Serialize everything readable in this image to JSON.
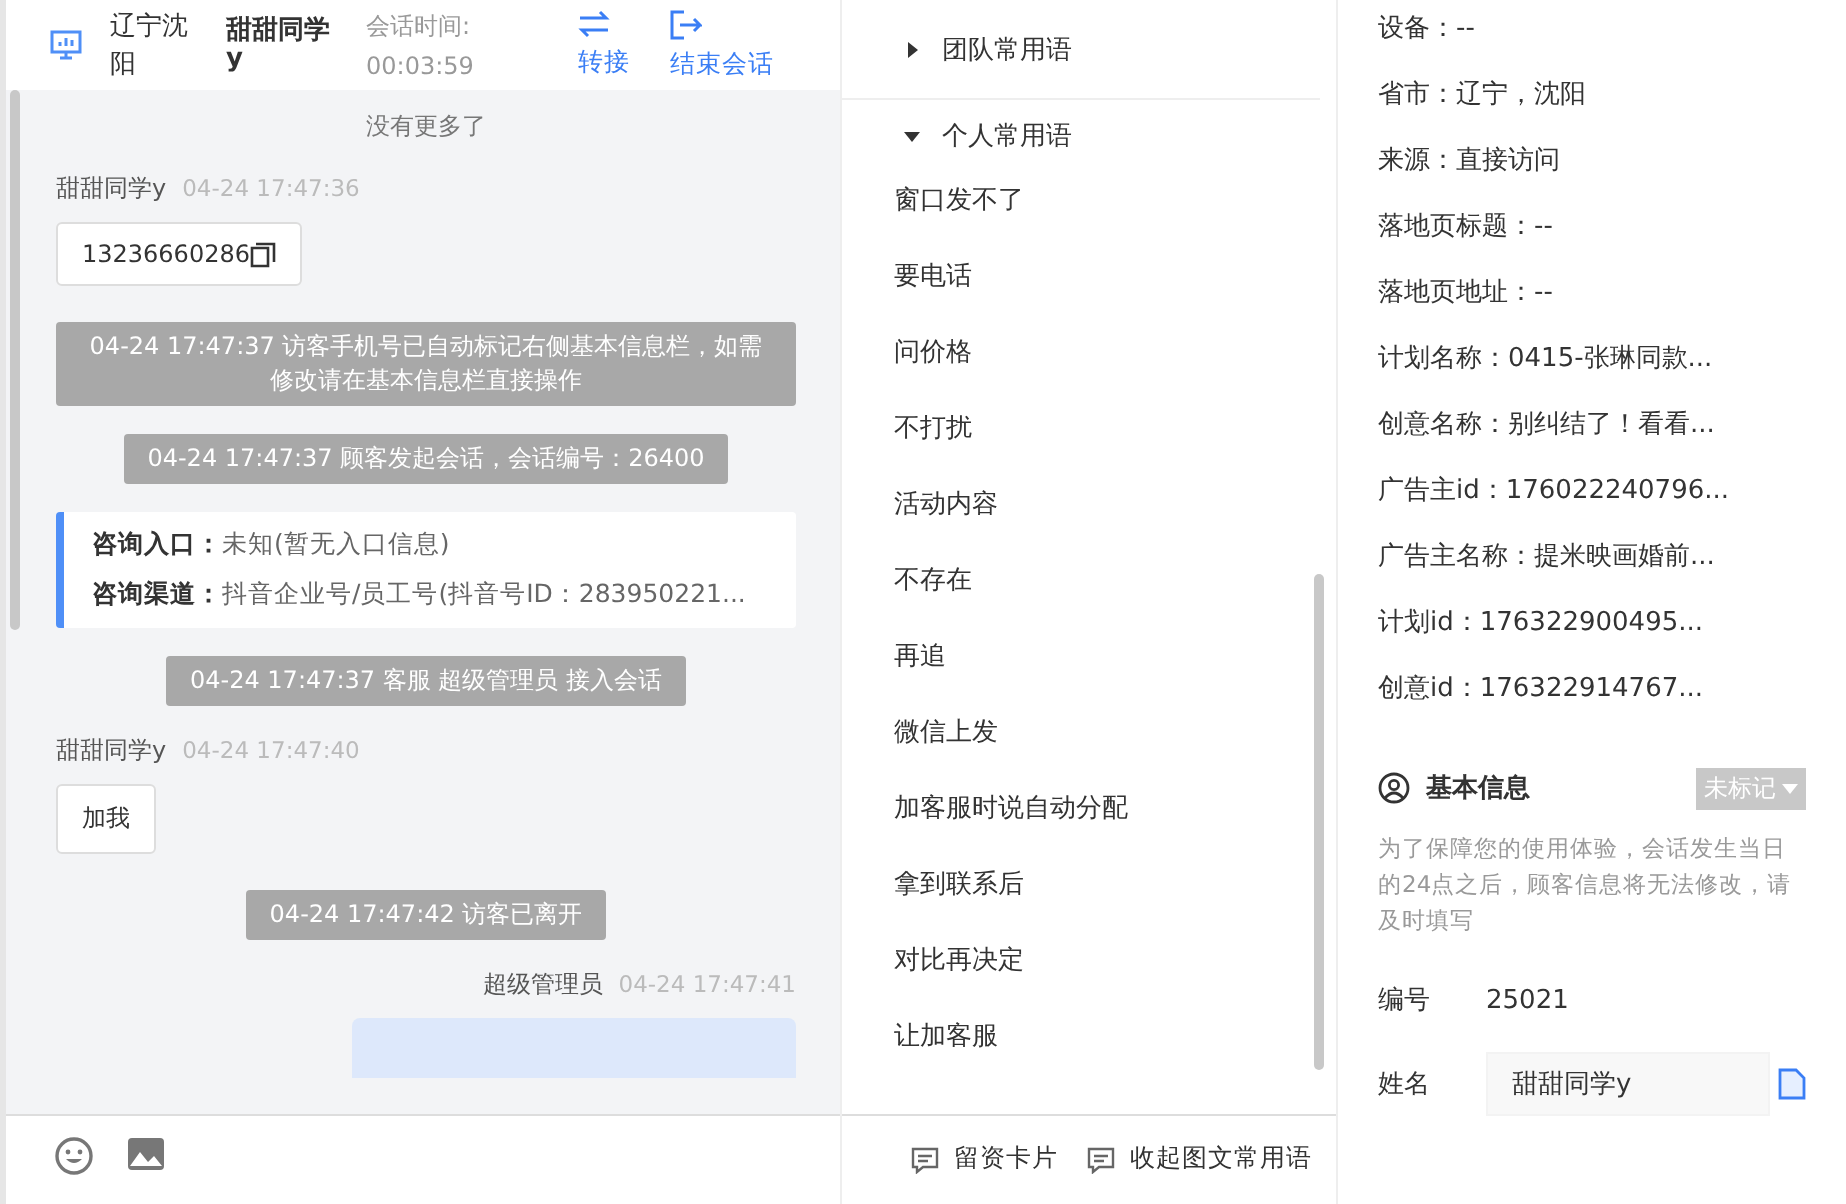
{
  "header": {
    "location": "辽宁沈阳",
    "visitor_name": "甜甜同学y",
    "session_time_label": "会话时间:",
    "session_time": "00:03:59",
    "actions": [
      {
        "label": "转接",
        "kind": "transfer"
      },
      {
        "label": "结束会话",
        "kind": "end"
      }
    ]
  },
  "chat": {
    "top_notice": "没有更多了",
    "messages": [
      {
        "kind": "visitor",
        "sender": "甜甜同学y",
        "time": "04-24 17:47:36",
        "text": "13236660286",
        "copyable": true
      },
      {
        "kind": "system",
        "text": "04-24 17:47:37 访客手机号已自动标记右侧基本信息栏，如需修改请在基本信息栏直接操作"
      },
      {
        "kind": "system",
        "text": "04-24 17:47:37 顾客发起会话，会话编号：26400"
      },
      {
        "kind": "entry",
        "lines": [
          {
            "label": "咨询入口：",
            "value": "未知(暂无入口信息)"
          },
          {
            "label": "咨询渠道：",
            "value": "抖音企业号/员工号(抖音号ID：283950221..."
          }
        ]
      },
      {
        "kind": "system",
        "text": "04-24 17:47:37 客服 超级管理员 接入会话"
      },
      {
        "kind": "visitor",
        "sender": "甜甜同学y",
        "time": "04-24 17:47:40",
        "text": "加我",
        "copyable": false
      },
      {
        "kind": "system",
        "text": "04-24 17:47:42 访客已离开"
      },
      {
        "kind": "agent",
        "sender": "超级管理员",
        "time": "04-24 17:47:41"
      }
    ]
  },
  "toolbar": {
    "actions": [
      "留资卡片",
      "收起图文常用语"
    ]
  },
  "phrases": {
    "groups": [
      {
        "title": "团队常用语",
        "expanded": false
      },
      {
        "title": "个人常用语",
        "expanded": true,
        "items": [
          "窗口发不了",
          "要电话",
          "问价格",
          "不打扰",
          "活动内容",
          "不存在",
          "再追",
          "微信上发",
          "加客服时说自动分配",
          "拿到联系后",
          "对比再决定",
          "让加客服"
        ]
      }
    ]
  },
  "visitor_info": {
    "rows": [
      "设备：--",
      "省市：辽宁，沈阳",
      "来源：直接访问",
      "落地页标题：--",
      "落地页地址：--",
      "计划名称：0415-张琳同款...",
      "创意名称：别纠结了！看看...",
      "广告主id：176022240796...",
      "广告主名称：提米映画婚前...",
      "计划id：176322900495...",
      "创意id：176322914767..."
    ]
  },
  "basic_info": {
    "title": "基本信息",
    "tag": "未标记",
    "notice": "为了保障您的使用体验，会话发生当日的24点之后，顾客信息将无法修改，请及时填写",
    "fields": [
      {
        "kind": "text",
        "label": "编号",
        "value": "25021"
      },
      {
        "kind": "input",
        "label": "姓名",
        "value": "甜甜同学y"
      }
    ]
  }
}
